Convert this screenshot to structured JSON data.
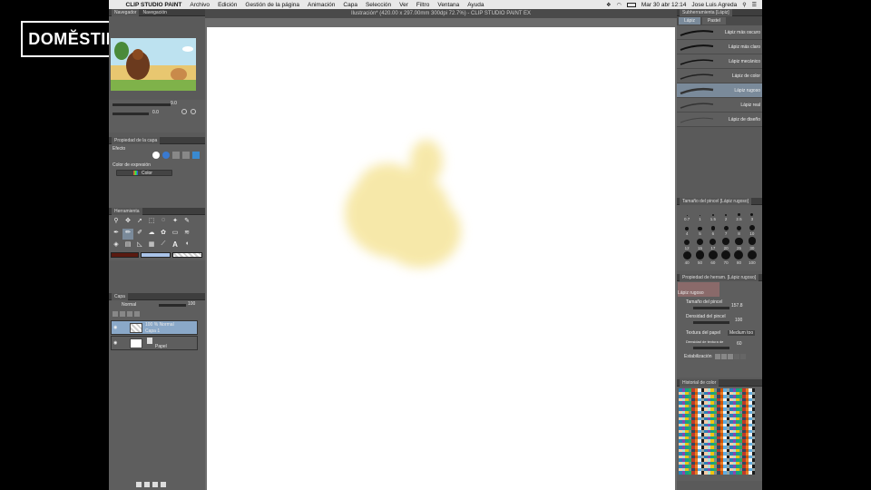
{
  "watermark": {
    "logo": "DOMĔSTIKA"
  },
  "menubar": {
    "app": "CLIP STUDIO PAINT",
    "items": [
      "Archivo",
      "Edición",
      "Gestión de la página",
      "Animación",
      "Capa",
      "Selección",
      "Ver",
      "Filtro",
      "Ventana",
      "Ayuda"
    ],
    "clock": "Mar 30 abr  12:14",
    "user": "Jose Luis Agreda"
  },
  "document": {
    "title": "Ilustración* (420.00 x 297.00mm 300dpi 72.7%)  - CLIP STUDIO PAINT EX"
  },
  "left_panel": {
    "navigator_tabs": [
      "Navegador",
      "Navegación"
    ],
    "navigator_zoom": "9.0",
    "navigator_rotation": "0.0",
    "layer_property": {
      "tab": "Propiedad de la capa",
      "effect_label": "Efecto",
      "expression_label": "Color de expresión",
      "expression_value": "Color"
    },
    "tool": {
      "tab": "Herramienta"
    },
    "colors": {
      "main": "#5a1a10",
      "sub": "#a9c3e8"
    },
    "layers": {
      "tab": "Capa",
      "blend_mode": "Normal",
      "opacity": "100",
      "items": [
        {
          "line1": "100 % Normal",
          "line2": "Capa 1"
        },
        {
          "line1": "",
          "line2": "Papel"
        }
      ]
    }
  },
  "right_panel": {
    "subtool": {
      "tab": "Subherramienta [Lápiz]",
      "groups": [
        "Lápiz",
        "Pastel"
      ],
      "brushes": [
        "Lápiz más oscuro",
        "Lápiz más claro",
        "Lápiz mecánico",
        "Lápiz de color",
        "Lápiz rugoso",
        "Lápiz real",
        "Lápiz de diseño"
      ],
      "selected_index": 4
    },
    "brush_size": {
      "tab": "Tamaño del pincel [Lápiz rugoso]",
      "sizes": [
        "0.7",
        "1",
        "1.5",
        "2",
        "2.5",
        "3",
        "4",
        "5",
        "6",
        "7",
        "8",
        "10",
        "12",
        "15",
        "17",
        "20",
        "25",
        "30",
        "40",
        "50",
        "60",
        "70",
        "80",
        "100"
      ]
    },
    "tool_property": {
      "tab": "Propiedad de herram. [Lápiz rugoso]",
      "preview_label": "Lápiz rugoso",
      "brush_size_label": "Tamaño del pincel",
      "brush_size_value": "157.8",
      "density_label": "Densidad del pincel",
      "density_value": "100",
      "texture_label": "Textura del papel",
      "texture_value": "Medium too",
      "texture_density_label": "Densidad de textura de",
      "texture_density_value": "60",
      "stabilization_label": "Estabilización"
    },
    "color_history": {
      "tab": "Historial de color"
    }
  }
}
